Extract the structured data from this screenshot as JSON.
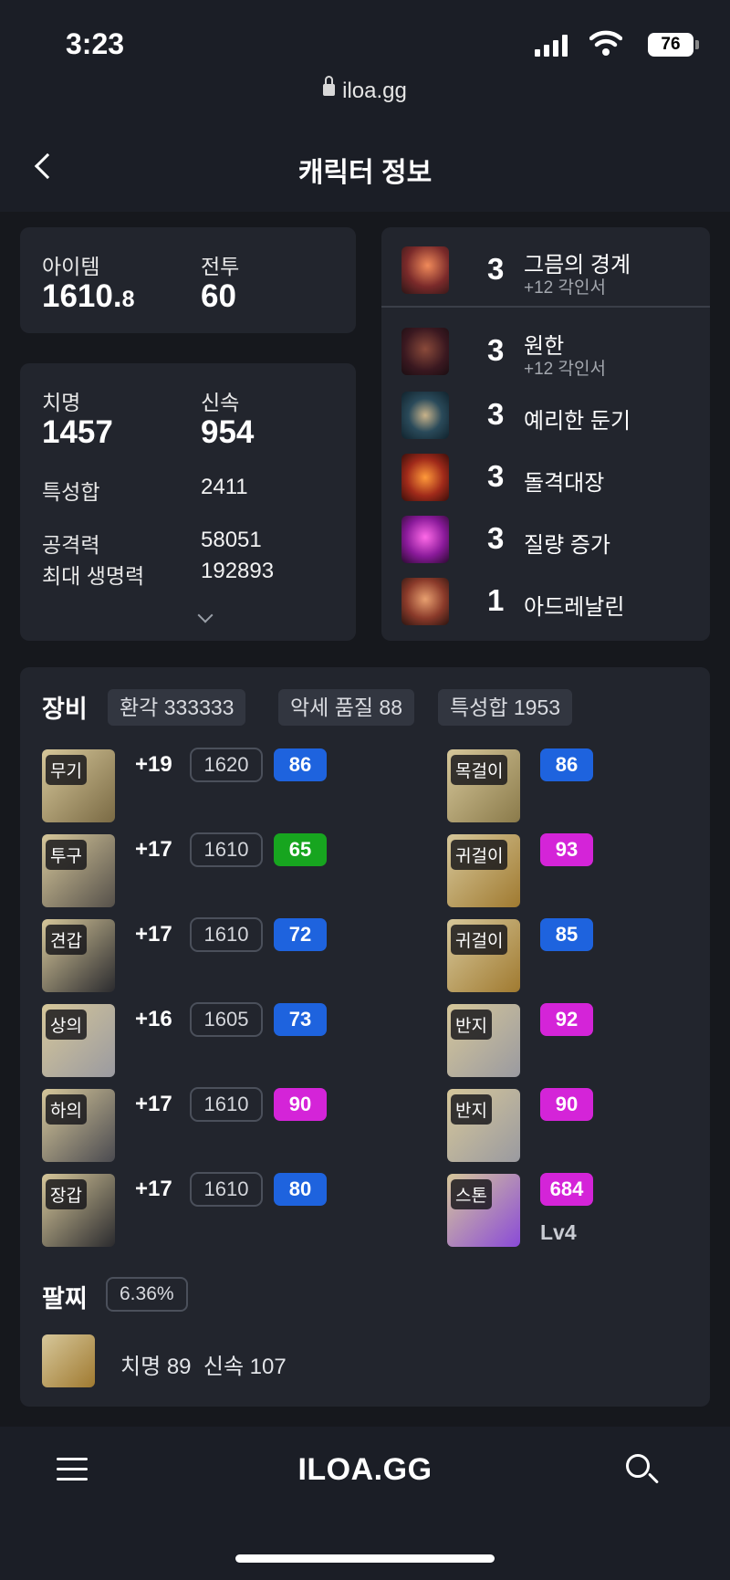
{
  "status": {
    "time": "3:23",
    "battery": "76"
  },
  "browser": {
    "url": "iloa.gg"
  },
  "nav": {
    "title": "캐릭터 정보"
  },
  "summary": {
    "item_label": "아이템",
    "item_value": "1610.",
    "item_decimal": "8",
    "battle_label": "전투",
    "battle_value": "60"
  },
  "stats": {
    "crit_label": "치명",
    "crit_value": "1457",
    "swift_label": "신속",
    "swift_value": "954",
    "total_label": "특성합",
    "total_value": "2411",
    "atk_label": "공격력",
    "atk_value": "58051",
    "hp_label": "최대 생명력",
    "hp_value": "192893"
  },
  "engravings": [
    {
      "level": "3",
      "name": "그믐의 경계",
      "sub": "+12 각인서",
      "icon": "twilight-icon"
    },
    {
      "level": "3",
      "name": "원한",
      "sub": "+12 각인서",
      "icon": "grudge-icon"
    },
    {
      "level": "3",
      "name": "예리한 둔기",
      "sub": "",
      "icon": "keen-blunt-icon"
    },
    {
      "level": "3",
      "name": "돌격대장",
      "sub": "",
      "icon": "raid-captain-icon"
    },
    {
      "level": "3",
      "name": "질량 증가",
      "sub": "",
      "icon": "mass-increase-icon"
    },
    {
      "level": "1",
      "name": "아드레날린",
      "sub": "",
      "icon": "adrenaline-icon"
    }
  ],
  "equipment": {
    "title": "장비",
    "chips": [
      "환각 333333",
      "악세 품질 88",
      "특성합 1953"
    ],
    "gear": [
      {
        "slot": "무기",
        "upgrade": "+19",
        "ilvl": "1620",
        "quality": "86",
        "color": "#1e63de"
      },
      {
        "slot": "투구",
        "upgrade": "+17",
        "ilvl": "1610",
        "quality": "65",
        "color": "#17a51f"
      },
      {
        "slot": "견갑",
        "upgrade": "+17",
        "ilvl": "1610",
        "quality": "72",
        "color": "#1e63de"
      },
      {
        "slot": "상의",
        "upgrade": "+16",
        "ilvl": "1605",
        "quality": "73",
        "color": "#1e63de"
      },
      {
        "slot": "하의",
        "upgrade": "+17",
        "ilvl": "1610",
        "quality": "90",
        "color": "#d424d8"
      },
      {
        "slot": "장갑",
        "upgrade": "+17",
        "ilvl": "1610",
        "quality": "80",
        "color": "#1e63de"
      }
    ],
    "accessories": [
      {
        "slot": "목걸이",
        "quality": "86",
        "color": "#1e63de"
      },
      {
        "slot": "귀걸이",
        "quality": "93",
        "color": "#d424d8"
      },
      {
        "slot": "귀걸이",
        "quality": "85",
        "color": "#1e63de"
      },
      {
        "slot": "반지",
        "quality": "92",
        "color": "#d424d8"
      },
      {
        "slot": "반지",
        "quality": "90",
        "color": "#d424d8"
      },
      {
        "slot": "스톤",
        "quality": "684",
        "color": "#d424d8",
        "extra": "Lv4"
      }
    ]
  },
  "bracelet": {
    "title": "팔찌",
    "percent": "6.36%",
    "effects": "치명 89  신속 107"
  },
  "footer": {
    "brand": "ILOA.GG"
  }
}
